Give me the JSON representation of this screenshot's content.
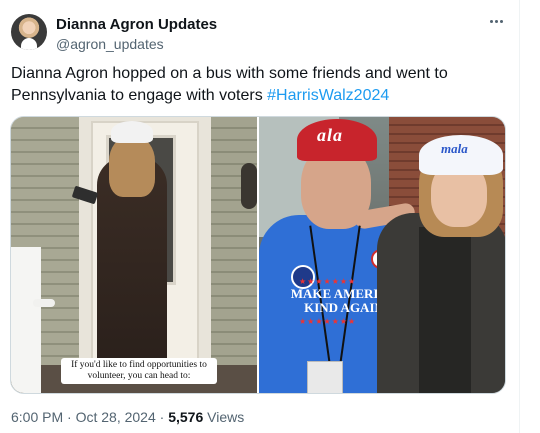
{
  "author": {
    "display_name": "Dianna Agron Updates",
    "handle": "@agron_updates"
  },
  "tweet": {
    "text": "Dianna Agron hopped on a bus with some friends and went to Pennsylvania to engage with voters ",
    "hashtag": "#HarrisWalz2024"
  },
  "media": {
    "left_photo": {
      "caption": "If you'd like to find opportunities to volunteer, you can head to:"
    },
    "right_photo": {
      "cap_text_man": "ala",
      "cap_text_woman": "mala",
      "shirt_text_line1": "MAKE AMERICA",
      "shirt_text_line2": "KIND AGAIN"
    }
  },
  "meta": {
    "time": "6:00 PM",
    "separator": " · ",
    "date": "Oct 28, 2024",
    "views_count": "5,576",
    "views_label": " Views"
  },
  "icons": {
    "more": "more-icon"
  }
}
